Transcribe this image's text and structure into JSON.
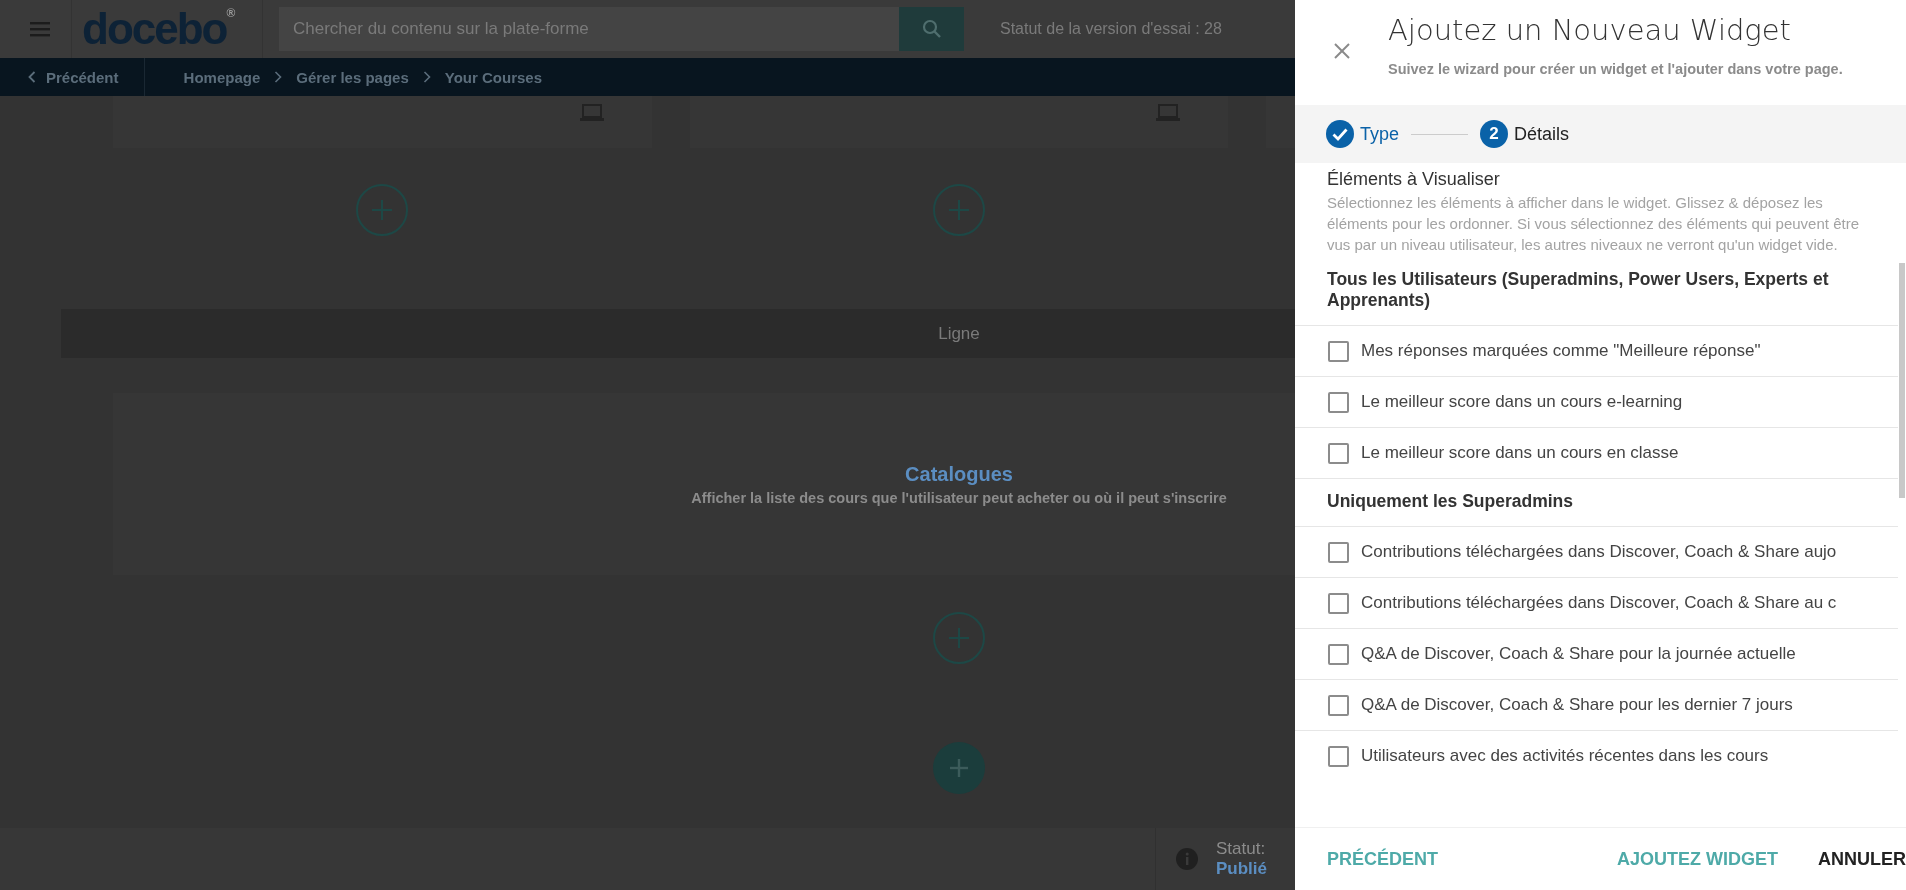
{
  "top_bar": {
    "logo": "docebo$^{®}$",
    "search": {
      "placeholder": "Chercher du contenu sur la plate-forme"
    },
    "trial_status": "Statut de la version d'essai : 28"
  },
  "breadcrumb": {
    "back": "Précédent",
    "items": [
      "Homepage",
      "Gérer les pages",
      "Your Courses"
    ]
  },
  "page": {
    "row_label": "Ligne",
    "widget": {
      "title": "Catalogues",
      "description": "Afficher la liste des cours que l'utilisateur peut acheter ou où il peut s'inscrire"
    }
  },
  "status": {
    "label": "Statut:",
    "value": "Publié"
  },
  "panel": {
    "title": "Ajoutez un Nouveau Widget",
    "subtitle": "Suivez le wizard pour créer un widget et l'ajouter dans votre page.",
    "steps": [
      {
        "label": "Type",
        "done": true
      },
      {
        "label": "Détails",
        "number": "2",
        "done": false
      }
    ],
    "section": {
      "heading": "Éléments à Visualiser",
      "description": "Sélectionnez les éléments à afficher dans le widget. Glissez & déposez les éléments pour les ordonner. Si vous sélectionnez des éléments qui peuvent être vus par un niveau utilisateur, les autres niveaux ne verront qu'un widget vide."
    },
    "groups": [
      {
        "title": "Tous les Utilisateurs (Superadmins, Power Users, Experts et Apprenants)",
        "items": [
          {
            "label": "Mes réponses marquées comme \"Meilleure réponse\"",
            "checked": false
          },
          {
            "label": "Le meilleur score dans un cours e-learning",
            "checked": false
          },
          {
            "label": "Le meilleur score dans un cours en classe",
            "checked": false
          }
        ]
      },
      {
        "title": "Uniquement les Superadmins",
        "items": [
          {
            "label": "Contributions téléchargées dans Discover, Coach & Share aujo",
            "checked": false
          },
          {
            "label": "Contributions téléchargées dans Discover, Coach & Share au c",
            "checked": false
          },
          {
            "label": "Q&A de Discover, Coach & Share pour la journée actuelle",
            "checked": false
          },
          {
            "label": "Q&A de Discover, Coach & Share pour les dernier 7 jours",
            "checked": false
          },
          {
            "label": "Utilisateurs avec des activités récentes dans les cours",
            "checked": false
          }
        ]
      }
    ],
    "buttons": [
      {
        "label": "PRÉCÉDENT",
        "kind": "link"
      },
      {
        "label": "AJOUTEZ WIDGET",
        "kind": "link"
      },
      {
        "label": "ANNULER",
        "kind": "cancel"
      }
    ]
  }
}
